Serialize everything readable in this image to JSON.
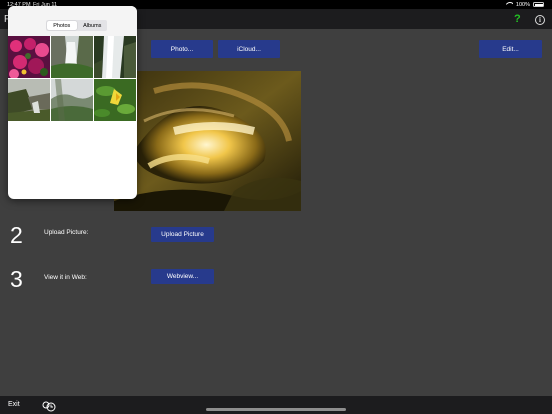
{
  "status_bar": {
    "time": "12:47 PM",
    "date": "Fri Jun 11",
    "battery": "100%"
  },
  "toolbar": {
    "title_partial": "P",
    "help_glyph": "?",
    "info_glyph": "i"
  },
  "buttons": {
    "photo": "Photo...",
    "icloud": "iCloud...",
    "edit": "Edit...",
    "upload": "Upload Picture",
    "webview": "Webview..."
  },
  "steps": [
    {
      "number": "2",
      "label": "Upload Picture:"
    },
    {
      "number": "3",
      "label": "View it in Web:"
    }
  ],
  "picker": {
    "tabs": [
      "Photos",
      "Albums"
    ],
    "selected_tab": "Photos",
    "thumbnails": [
      "pink-flowers",
      "waterfall-valley",
      "waterfall-cascade",
      "coastal-cliff",
      "foggy-valley",
      "yellow-lily"
    ]
  },
  "bottom": {
    "exit": "Exit"
  },
  "colors": {
    "accent_button": "#273a8c",
    "help_green": "#22c322",
    "background": "#3f3f3f"
  }
}
